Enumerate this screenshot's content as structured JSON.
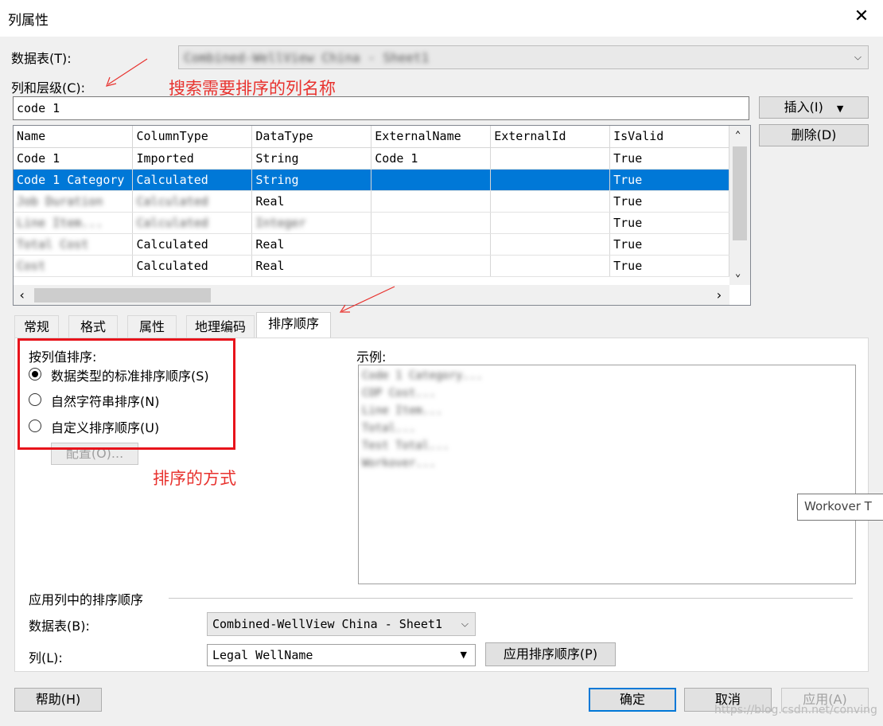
{
  "window": {
    "title": "列属性",
    "close": "✕"
  },
  "table_combo": {
    "label": "数据表(T):",
    "value": "Combined-WellView China - Sheet1"
  },
  "columns_section": {
    "label": "列和层级(C):",
    "input_value": "code 1"
  },
  "annotations": {
    "search_note": "搜索需要排序的列名称",
    "sort_mode_note": "排序的方式",
    "arrow_color": "#e8322e"
  },
  "buttons": {
    "insert": "插入(I)",
    "delete": "删除(D)",
    "configure": "配置(O)...",
    "help": "帮助(H)",
    "ok": "确定",
    "cancel": "取消",
    "apply": "应用(A)",
    "apply_sort": "应用排序顺序(P)"
  },
  "grid": {
    "headers": [
      "Name",
      "ColumnType",
      "DataType",
      "ExternalName",
      "ExternalId",
      "IsValid"
    ],
    "rows": [
      [
        "Code 1",
        "Imported",
        "String",
        "Code 1",
        "",
        "True"
      ],
      [
        "Code 1 Category",
        "Calculated",
        "String",
        "",
        "",
        "True"
      ],
      [
        "Job Duration",
        "Calculated",
        "Real",
        "",
        "",
        "True"
      ],
      [
        "Line Item...",
        "Calculated",
        "Integer",
        "",
        "",
        "True"
      ],
      [
        "Total Cost",
        "Calculated",
        "Real",
        "",
        "",
        "True"
      ],
      [
        "Cost",
        "Calculated",
        "Real",
        "",
        "",
        "True"
      ]
    ],
    "selected_row": 1,
    "blurred_rows": [
      2,
      3,
      4,
      5
    ]
  },
  "tabs": [
    {
      "label": "常规",
      "active": false
    },
    {
      "label": "格式",
      "active": false
    },
    {
      "label": "属性",
      "active": false
    },
    {
      "label": "地理编码",
      "active": false
    },
    {
      "label": "排序顺序",
      "active": true
    }
  ],
  "sort_by_values": {
    "label": "按列值排序:",
    "options": [
      {
        "label": "数据类型的标准排序顺序(S)",
        "checked": true
      },
      {
        "label": "自然字符串排序(N)",
        "checked": false
      },
      {
        "label": "自定义排序顺序(U)",
        "checked": false
      }
    ]
  },
  "example": {
    "label": "示例:",
    "lines": [
      "Code 1 Category...",
      "COP Cost...",
      "Line Item...",
      "Total...",
      "Test Total...",
      "Workover..."
    ],
    "tooltip": "Workover T"
  },
  "apply_section": {
    "title": "应用列中的排序顺序",
    "table_label": "数据表(B):",
    "table_value": "Combined-WellView China - Sheet1",
    "column_label": "列(L):",
    "column_value": "Legal WellName"
  },
  "watermark": "https://blog.csdn.net/conving",
  "colors": {
    "selection": "#0078d7",
    "red": "#e8322e",
    "focus_border": "#0078d7"
  }
}
